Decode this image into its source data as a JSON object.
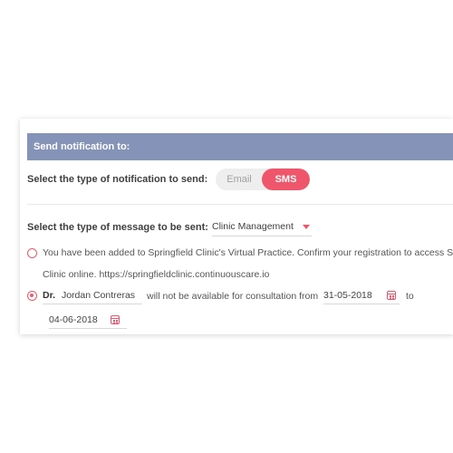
{
  "panel": {
    "header_title": "Send notification to:"
  },
  "notification_type": {
    "label": "Select the type of notification to send:",
    "options": [
      "Email",
      "SMS"
    ],
    "selected": "SMS"
  },
  "message_type": {
    "label": "Select the type of message to be sent:",
    "selected_value": "Clinic Management"
  },
  "options": {
    "registration": {
      "line1": "You have been added to Springfield Clinic's Virtual Practice. Confirm your registration to access S",
      "line2": "Clinic online. https://springfieldclinic.continuouscare.io"
    },
    "unavailable": {
      "prefix": "Dr.",
      "doctor_name": "Jordan Contreras",
      "middle_text": "will not be available for consultation from",
      "from_date": "31-05-2018",
      "to_word": "to",
      "to_date": "04-06-2018"
    }
  },
  "colors": {
    "header_bg": "#8593b8",
    "accent": "#f0566b"
  }
}
